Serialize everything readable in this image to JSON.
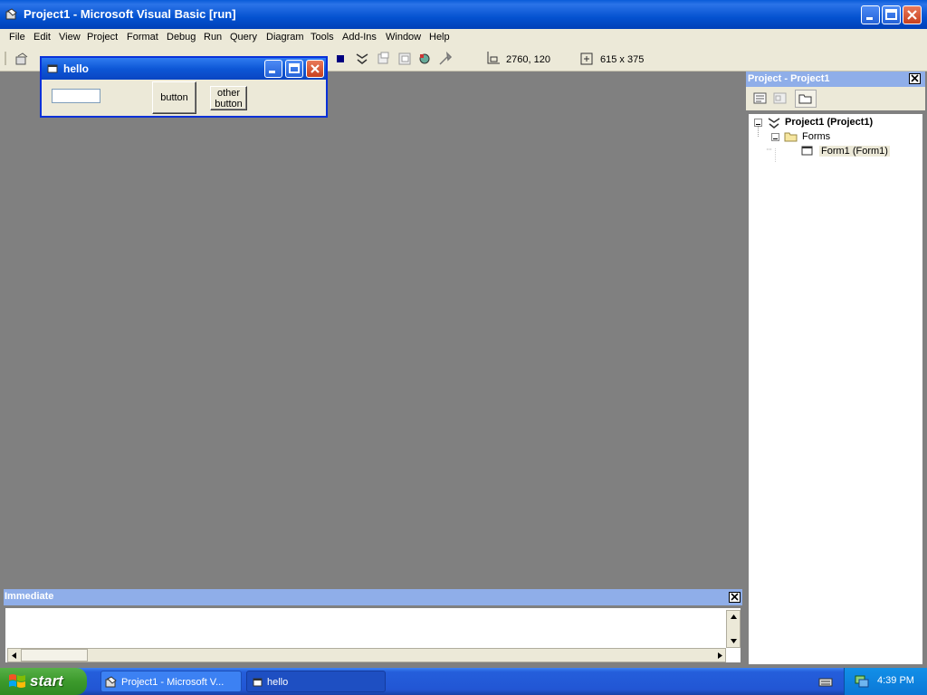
{
  "window": {
    "title": "Project1 - Microsoft Visual Basic [run]"
  },
  "menu": [
    "File",
    "Edit",
    "View",
    "Project",
    "Format",
    "Debug",
    "Run",
    "Query",
    "Diagram",
    "Tools",
    "Add-Ins",
    "Window",
    "Help"
  ],
  "toolbar": {
    "position": "2760, 120",
    "size": "615 x 375"
  },
  "form_window": {
    "title": "hello",
    "text_value": "",
    "button_label": "button",
    "other_button_line1": "other",
    "other_button_line2": "button"
  },
  "project_panel": {
    "title": "Project - Project1",
    "root": "Project1 (Project1)",
    "folder": "Forms",
    "form": "Form1 (Form1)"
  },
  "immediate": {
    "title": "Immediate"
  },
  "taskbar": {
    "start_label": "start",
    "tasks": [
      "Project1 - Microsoft V...",
      "hello"
    ],
    "clock": "4:39 PM"
  },
  "colors": {
    "xp_blue": "#0452d0",
    "panel_title": "#8faee9",
    "mdi_gray": "#808080",
    "face": "#ece9d8"
  }
}
